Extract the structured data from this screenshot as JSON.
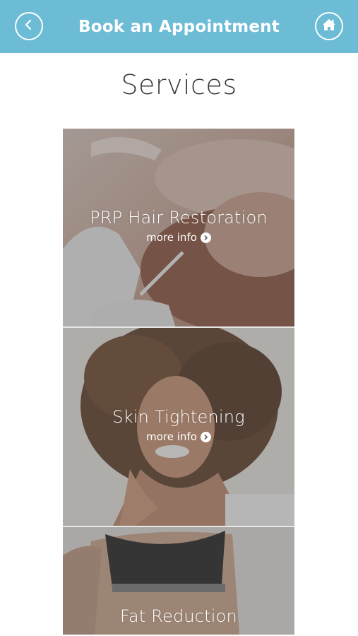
{
  "header": {
    "title": "Book an Appointment",
    "background": "#6dbcd6",
    "back_icon": "chevron-left-icon",
    "home_icon": "home-icon"
  },
  "page": {
    "heading": "Services"
  },
  "services": [
    {
      "title": "PRP Hair Restoration",
      "more_label": "more info"
    },
    {
      "title": "Skin Tightening",
      "more_label": "more info"
    },
    {
      "title": "Fat Reduction"
    }
  ]
}
